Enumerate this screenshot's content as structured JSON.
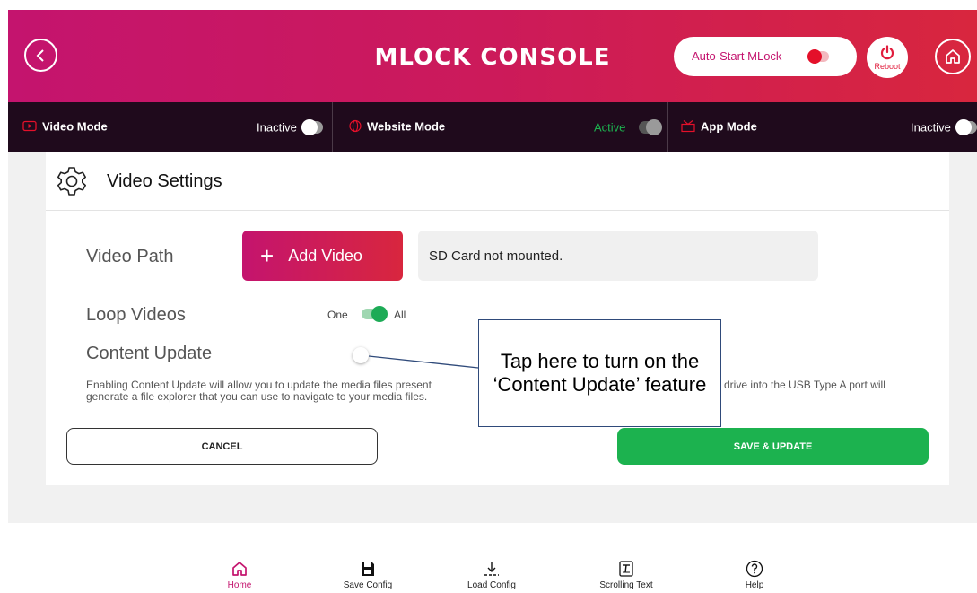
{
  "header": {
    "title": "MLOCK CONSOLE",
    "autostart_label": "Auto-Start MLock",
    "reboot_label": "Reboot",
    "colors": {
      "gradient_start": "#c4146e",
      "gradient_end": "#d8263e"
    }
  },
  "modes": [
    {
      "name": "Video Mode",
      "state": "Inactive",
      "icon": "play-icon"
    },
    {
      "name": "Website Mode",
      "state": "Active",
      "icon": "globe-icon"
    },
    {
      "name": "App Mode",
      "state": "Inactive",
      "icon": "app-icon"
    }
  ],
  "settings": {
    "title": "Video Settings",
    "video_path_label": "Video Path",
    "add_video_label": "Add Video",
    "path_value": "SD Card not mounted.",
    "loop_label": "Loop Videos",
    "loop_one": "One",
    "loop_all": "All",
    "content_update_label": "Content Update",
    "description_line1": "Enabling Content Update will allow you to update the media files present",
    "description_line1_end": "drive into the USB Type A port will",
    "description_line2": "generate a file explorer that you can use to navigate to your media files.",
    "cancel_label": "CANCEL",
    "save_label": "SAVE & UPDATE"
  },
  "callout": {
    "text": "Tap here to turn on the ‘Content Update’ feature"
  },
  "nav": [
    {
      "label": "Home",
      "icon": "home-icon",
      "active": true
    },
    {
      "label": "Save Config",
      "icon": "save-icon",
      "active": false
    },
    {
      "label": "Load Config",
      "icon": "download-icon",
      "active": false
    },
    {
      "label": "Scrolling Text",
      "icon": "scrolling-text-icon",
      "active": false
    },
    {
      "label": "Help",
      "icon": "help-icon",
      "active": false
    }
  ],
  "colors": {
    "active_green": "#1cb24f",
    "toggle_red": "#e4102a",
    "accent": "#c4146e"
  }
}
